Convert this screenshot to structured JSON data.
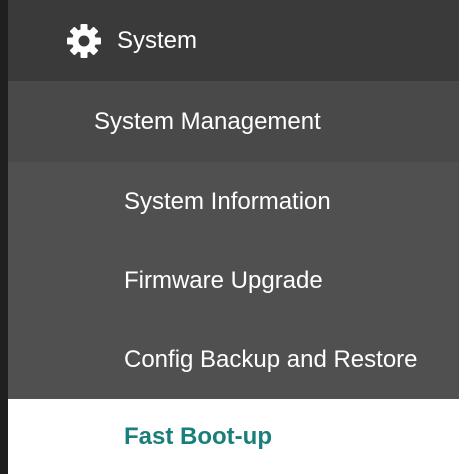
{
  "sidebar": {
    "section": {
      "icon": "gear-icon",
      "label": "System"
    },
    "group": {
      "label": "System Management"
    },
    "items": [
      {
        "label": "System Information",
        "active": false
      },
      {
        "label": "Firmware Upgrade",
        "active": false
      },
      {
        "label": "Config Backup and Restore",
        "active": false
      },
      {
        "label": "Fast Boot-up",
        "active": true
      }
    ]
  },
  "colors": {
    "accent": "#1a7f7b",
    "section_bg": "#3a3a3a",
    "group_bg": "#494949",
    "item_bg": "#505050",
    "active_bg": "#ffffff"
  }
}
